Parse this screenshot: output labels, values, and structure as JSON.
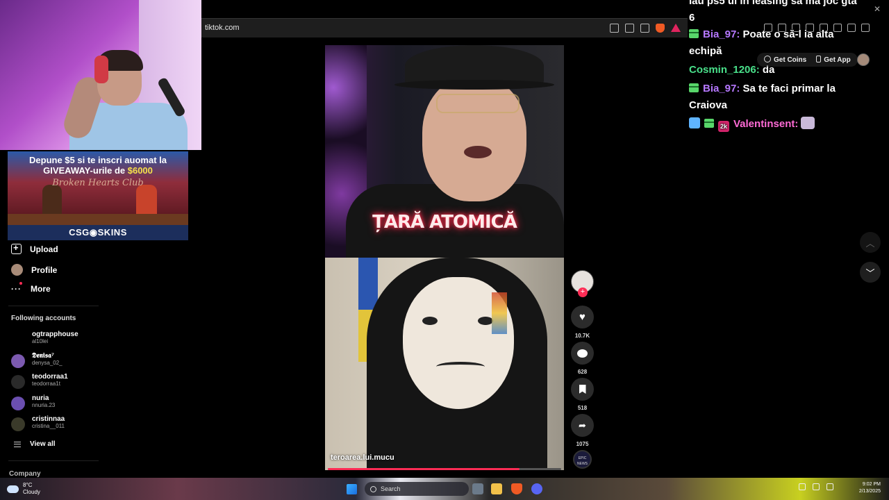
{
  "browser": {
    "url": "tiktok.com"
  },
  "chat": {
    "messages": [
      {
        "id": "m0",
        "user": "",
        "text": "Iau ps5 ul in leasing sa ma joc gta 6",
        "line1": "Iau ps5 ul în leasing să mă joc gta",
        "line2": "6"
      },
      {
        "id": "m1",
        "user": "Bia_97:",
        "text": "Poate o să-l ia alta",
        "line2": "echipă"
      },
      {
        "id": "m2",
        "user": "Cosmin_1206:",
        "text": "da"
      },
      {
        "id": "m3",
        "user": "Bia_97:",
        "text": "Sa te faci primar la",
        "line2": "Craiova"
      },
      {
        "id": "m4",
        "user": "Valentinsent:",
        "text": "",
        "badge": "2k"
      }
    ]
  },
  "header": {
    "get_coins": "Get Coins",
    "get_app": "Get App"
  },
  "promo": {
    "line1": "Depune $5 si te inscri auomat la",
    "line2_prefix": "GIVEAWAY-urile de ",
    "line2_amount": "$6000",
    "club": "Broken Hearts Club",
    "brand": "CSG◉SKINS"
  },
  "sidebar": {
    "nav": [
      {
        "label": "Upload",
        "icon": "upload-icon"
      },
      {
        "label": "Profile",
        "icon": "profile-icon"
      },
      {
        "label": "More",
        "icon": "more-icon"
      }
    ],
    "following_title": "Following accounts",
    "accounts": [
      {
        "name": "ogtrapphouse",
        "handle": "al10lei",
        "color": "#000000"
      },
      {
        "name": "𝕯𝖊𝖓𝖎𝖘𝖆⁷",
        "handle": "denysa_02_",
        "color": "#7c5ab0"
      },
      {
        "name": "teodorraa1",
        "handle": "teodorraa1t",
        "color": "#2a2a2a"
      },
      {
        "name": "nuria",
        "handle": "nnuria.23",
        "color": "#6b4fb0"
      },
      {
        "name": "cristinnaa",
        "handle": "cristina__011",
        "color": "#3a3a2a"
      }
    ],
    "view_all": "View all",
    "company": "Company"
  },
  "video": {
    "caption": "ȚARĂ ATOMICĂ",
    "author": "teroarea.lui.mucu",
    "progress": 0.82
  },
  "actions": {
    "likes": "10.7K",
    "comments": "628",
    "saves": "518",
    "shares": "1075",
    "follow_symbol": "+",
    "disc_text": "EPIC NEWS"
  },
  "taskbar": {
    "temp": "8°C",
    "condition": "Cloudy",
    "search": "Search",
    "time": "9:02 PM",
    "date": "2/13/2025"
  },
  "colors": {
    "accent": "#fe2c55",
    "chat_purple": "#b678ff",
    "chat_green": "#49e08a",
    "chat_pink": "#ff6bd6"
  }
}
